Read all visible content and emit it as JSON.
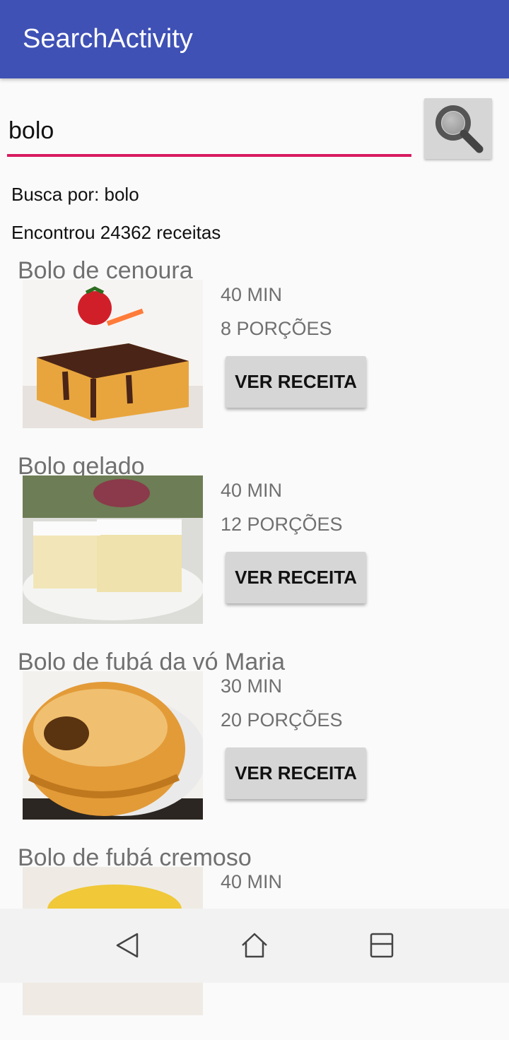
{
  "app": {
    "title": "SearchActivity",
    "primary_color": "#3f51b5",
    "accent_color": "#d81b60"
  },
  "search": {
    "value": "bolo",
    "button_icon": "search-icon"
  },
  "results": {
    "query_text": "Busca por: bolo",
    "count_text": "Encontrou 24362 receitas"
  },
  "recipes": [
    {
      "title": "Bolo de cenoura",
      "time": "40 MIN",
      "servings": "8 PORÇÕES",
      "button": "VER RECEITA"
    },
    {
      "title": "Bolo gelado",
      "time": "40 MIN",
      "servings": "12 PORÇÕES",
      "button": "VER RECEITA"
    },
    {
      "title": "Bolo de fubá da vó Maria",
      "time": "30 MIN",
      "servings": "20 PORÇÕES",
      "button": "VER RECEITA"
    },
    {
      "title": "Bolo de fubá cremoso",
      "time": "40 MIN",
      "servings": "",
      "button": ""
    }
  ],
  "navbar": {
    "back": "back-icon",
    "home": "home-icon",
    "recents": "recents-icon"
  }
}
